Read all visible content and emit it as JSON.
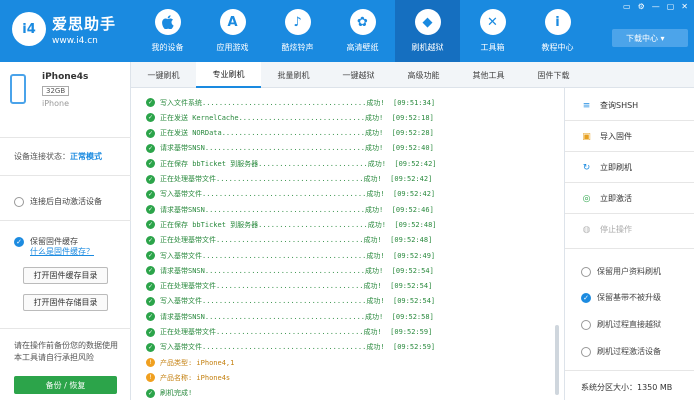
{
  "header": {
    "logo_badge": "i4",
    "logo_title": "爱思助手",
    "logo_url": "www.i4.cn",
    "nav": [
      {
        "label": "我的设备",
        "icon": ""
      },
      {
        "label": "应用游戏",
        "icon": "A"
      },
      {
        "label": "酷炫铃声",
        "icon": "♪"
      },
      {
        "label": "高清壁纸",
        "icon": "✿"
      },
      {
        "label": "刷机越狱",
        "icon": "◆"
      },
      {
        "label": "工具箱",
        "icon": "✕"
      },
      {
        "label": "教程中心",
        "icon": "i"
      }
    ],
    "window_controls": [
      "▭",
      "⚙",
      "—",
      "▢",
      "✕"
    ],
    "download_center": "下载中心 ▾"
  },
  "device": {
    "name": "iPhone4s",
    "capacity": "32GB",
    "model": "iPhone"
  },
  "left": {
    "conn_label": "设备连接状态：",
    "conn_value": "正常模式",
    "auto_activate": "连接后自动激活设备",
    "keep_cache": "保留固件缓存",
    "what_is_cache": "什么是固件缓存？",
    "open_cache_btn": "打开固件缓存目录",
    "open_storage_btn": "打开固件存储目录",
    "notice": "请在操作前备份您的数据使用本工具请自行承担风险",
    "backup_btn": "备份 / 恢复"
  },
  "tabs": [
    "一键刷机",
    "专业刷机",
    "批量刷机",
    "一键越狱",
    "高级功能",
    "其他工具",
    "固件下载"
  ],
  "log": [
    {
      "text": "写入文件系统.......................................成功!  [09:51:34]",
      "kind": "ok"
    },
    {
      "text": "正在发送 KernelCache..............................成功!  [09:52:18]",
      "kind": "ok"
    },
    {
      "text": "正在发送 NORData..................................成功!  [09:52:28]",
      "kind": "ok"
    },
    {
      "text": "请求基带SNSN......................................成功!  [09:52:40]",
      "kind": "ok"
    },
    {
      "text": "正在保存 bbTicket 到服务器..........................成功!  [09:52:42]",
      "kind": "ok"
    },
    {
      "text": "正在处理基带文件...................................成功!  [09:52:42]",
      "kind": "ok"
    },
    {
      "text": "写入基带文件.......................................成功!  [09:52:42]",
      "kind": "ok"
    },
    {
      "text": "请求基带SNSN......................................成功!  [09:52:46]",
      "kind": "ok"
    },
    {
      "text": "正在保存 bbTicket 到服务器..........................成功!  [09:52:48]",
      "kind": "ok"
    },
    {
      "text": "正在处理基带文件...................................成功!  [09:52:48]",
      "kind": "ok"
    },
    {
      "text": "写入基带文件.......................................成功!  [09:52:49]",
      "kind": "ok"
    },
    {
      "text": "请求基带SNSN......................................成功!  [09:52:54]",
      "kind": "ok"
    },
    {
      "text": "正在处理基带文件...................................成功!  [09:52:54]",
      "kind": "ok"
    },
    {
      "text": "写入基带文件.......................................成功!  [09:52:54]",
      "kind": "ok"
    },
    {
      "text": "请求基带SNSN......................................成功!  [09:52:58]",
      "kind": "ok"
    },
    {
      "text": "正在处理基带文件...................................成功!  [09:52:59]",
      "kind": "ok"
    },
    {
      "text": "写入基带文件.......................................成功!  [09:52:59]",
      "kind": "ok"
    },
    {
      "text": "产品类型: iPhone4,1",
      "kind": "warn"
    },
    {
      "text": "产品名称: iPhone4s",
      "kind": "warn"
    },
    {
      "text": "刷机完成!",
      "kind": "ok"
    }
  ],
  "right": {
    "actions": [
      {
        "label": "查询SHSH",
        "icon": "≡",
        "enabled": true
      },
      {
        "label": "导入固件",
        "icon": "▣",
        "enabled": true
      },
      {
        "label": "立即刷机",
        "icon": "↻",
        "enabled": true
      },
      {
        "label": "立即激活",
        "icon": "◎",
        "enabled": true
      },
      {
        "label": "停止操作",
        "icon": "◍",
        "enabled": false
      }
    ],
    "options": [
      {
        "label": "保留用户资料刷机",
        "checked": false
      },
      {
        "label": "保留基带不被升级",
        "checked": true
      },
      {
        "label": "刷机过程直接越狱",
        "checked": false
      },
      {
        "label": "刷机过程激活设备",
        "checked": false
      }
    ],
    "partition": "系统分区大小：1350 MB"
  }
}
